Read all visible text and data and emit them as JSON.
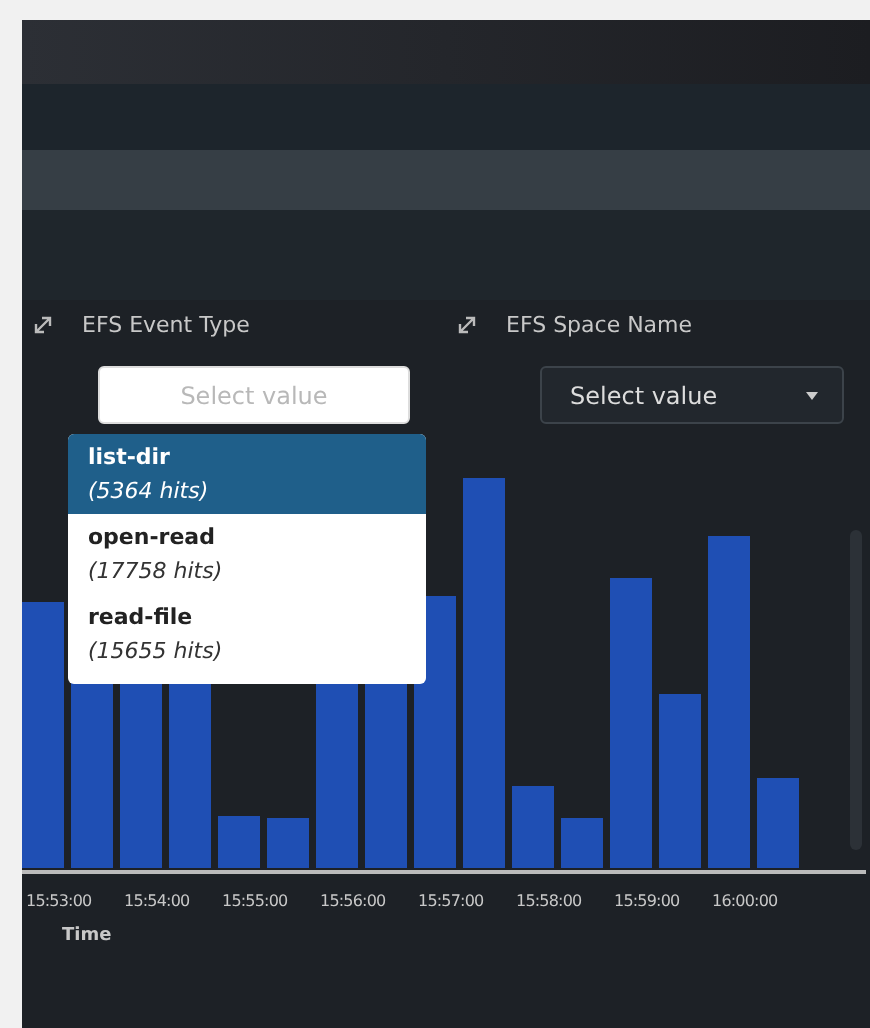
{
  "filters": [
    {
      "label": "EFS Event Type",
      "placeholder": "Select value",
      "kind": "open",
      "options": [
        {
          "name": "list-dir",
          "hits": "(5364 hits)",
          "selected": true
        },
        {
          "name": "open-read",
          "hits": "(17758 hits)",
          "selected": false
        },
        {
          "name": "read-file",
          "hits": "(15655 hits)",
          "selected": false
        }
      ]
    },
    {
      "label": "EFS Space Name",
      "placeholder": "Select value",
      "kind": "closed"
    }
  ],
  "chart": {
    "xticks": [
      "15:53:00",
      "15:54:00",
      "15:55:00",
      "15:56:00",
      "15:57:00",
      "15:58:00",
      "15:59:00",
      "16:00:00"
    ],
    "xlabel": "Time"
  }
}
